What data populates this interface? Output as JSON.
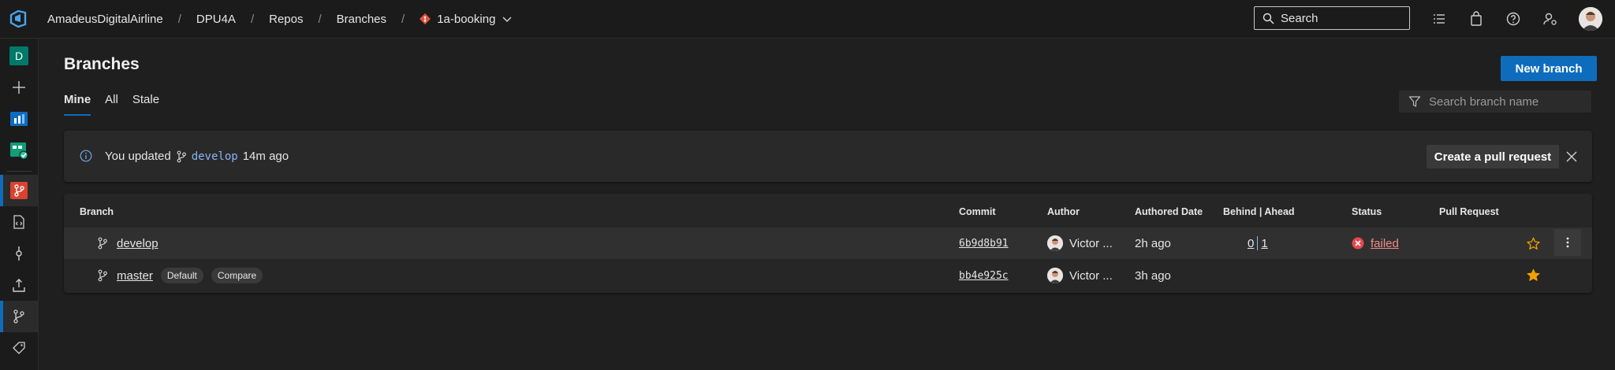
{
  "header": {
    "breadcrumbs": [
      "AmadeusDigitalAirline",
      "DPU4A",
      "Repos",
      "Branches"
    ],
    "repo": "1a-booking",
    "search_placeholder": "Search",
    "icons": [
      "azure-devops-logo",
      "list-icon",
      "shopping-bag-icon",
      "help-icon",
      "user-settings-icon"
    ]
  },
  "rail": {
    "project_initial": "D",
    "project_color": "#00796b"
  },
  "page": {
    "title": "Branches",
    "new_branch_label": "New branch",
    "tabs": [
      "Mine",
      "All",
      "Stale"
    ],
    "active_tab": "Mine",
    "filter_placeholder": "Search branch name"
  },
  "banner": {
    "prefix": "You updated",
    "branch": "develop",
    "suffix": "14m ago",
    "action_label": "Create a pull request"
  },
  "table": {
    "headers": [
      "Branch",
      "Commit",
      "Author",
      "Authored Date",
      "Behind | Ahead",
      "Status",
      "Pull Request"
    ],
    "rows": [
      {
        "branch": "develop",
        "badges": [],
        "commit": "6b9d8b91",
        "author": "Victor ...",
        "date": "2h ago",
        "behind": "0",
        "ahead": "1",
        "status": "failed",
        "starred": false
      },
      {
        "branch": "master",
        "badges": [
          "Default",
          "Compare"
        ],
        "commit": "bb4e925c",
        "author": "Victor ...",
        "date": "3h ago",
        "behind": "",
        "ahead": "",
        "status": "",
        "starred": true
      }
    ]
  },
  "colors": {
    "accent": "#0f6cbd",
    "failed": "#e5484d",
    "star": "#f2a100"
  }
}
